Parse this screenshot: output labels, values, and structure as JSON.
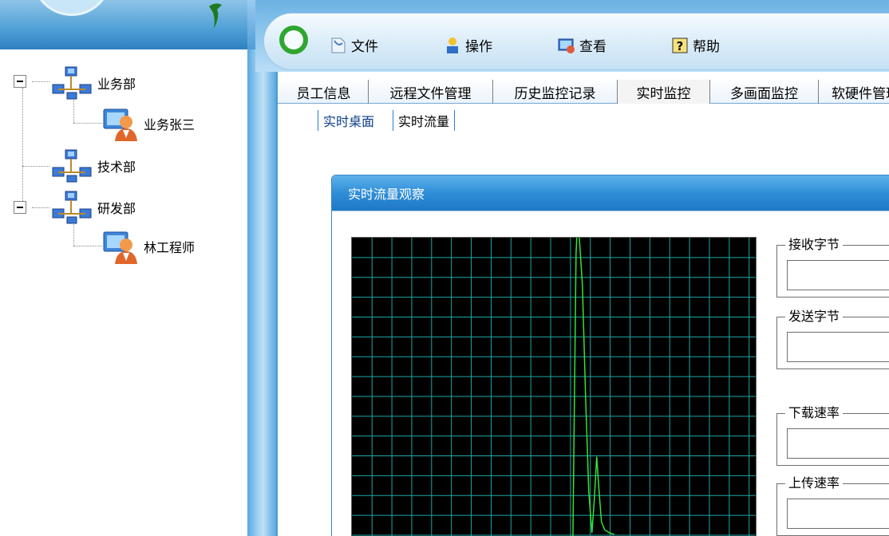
{
  "menu": {
    "items": [
      {
        "label": "文件",
        "icon": "file-icon"
      },
      {
        "label": "操作",
        "icon": "operation-icon"
      },
      {
        "label": "查看",
        "icon": "view-icon"
      },
      {
        "label": "帮助",
        "icon": "help-icon"
      }
    ]
  },
  "tree": {
    "nodes": [
      {
        "label": "业务部",
        "type": "department",
        "expanded": true
      },
      {
        "label": "业务张三",
        "type": "user"
      },
      {
        "label": "技术部",
        "type": "department"
      },
      {
        "label": "研发部",
        "type": "department",
        "expanded": true
      },
      {
        "label": "林工程师",
        "type": "user"
      }
    ]
  },
  "tabs": [
    {
      "label": "员工信息"
    },
    {
      "label": "远程文件管理"
    },
    {
      "label": "历史监控记录"
    },
    {
      "label": "实时监控",
      "active": true
    },
    {
      "label": "多画面监控"
    },
    {
      "label": "软硬件管理"
    }
  ],
  "subtabs": [
    {
      "label": "实时桌面",
      "active": true
    },
    {
      "label": "实时流量"
    }
  ],
  "panel": {
    "title": "实时流量观察",
    "groups": [
      {
        "label": "接收字节",
        "value": ""
      },
      {
        "label": "发送字节",
        "value": ""
      },
      {
        "label": "下载速率",
        "value": ""
      },
      {
        "label": "上传速率",
        "value": ""
      }
    ]
  },
  "colors": {
    "accent": "#2f8ed7",
    "graph_grid": "#1fa7a7",
    "graph_line": "#33e633",
    "graph_bg": "#000000"
  }
}
